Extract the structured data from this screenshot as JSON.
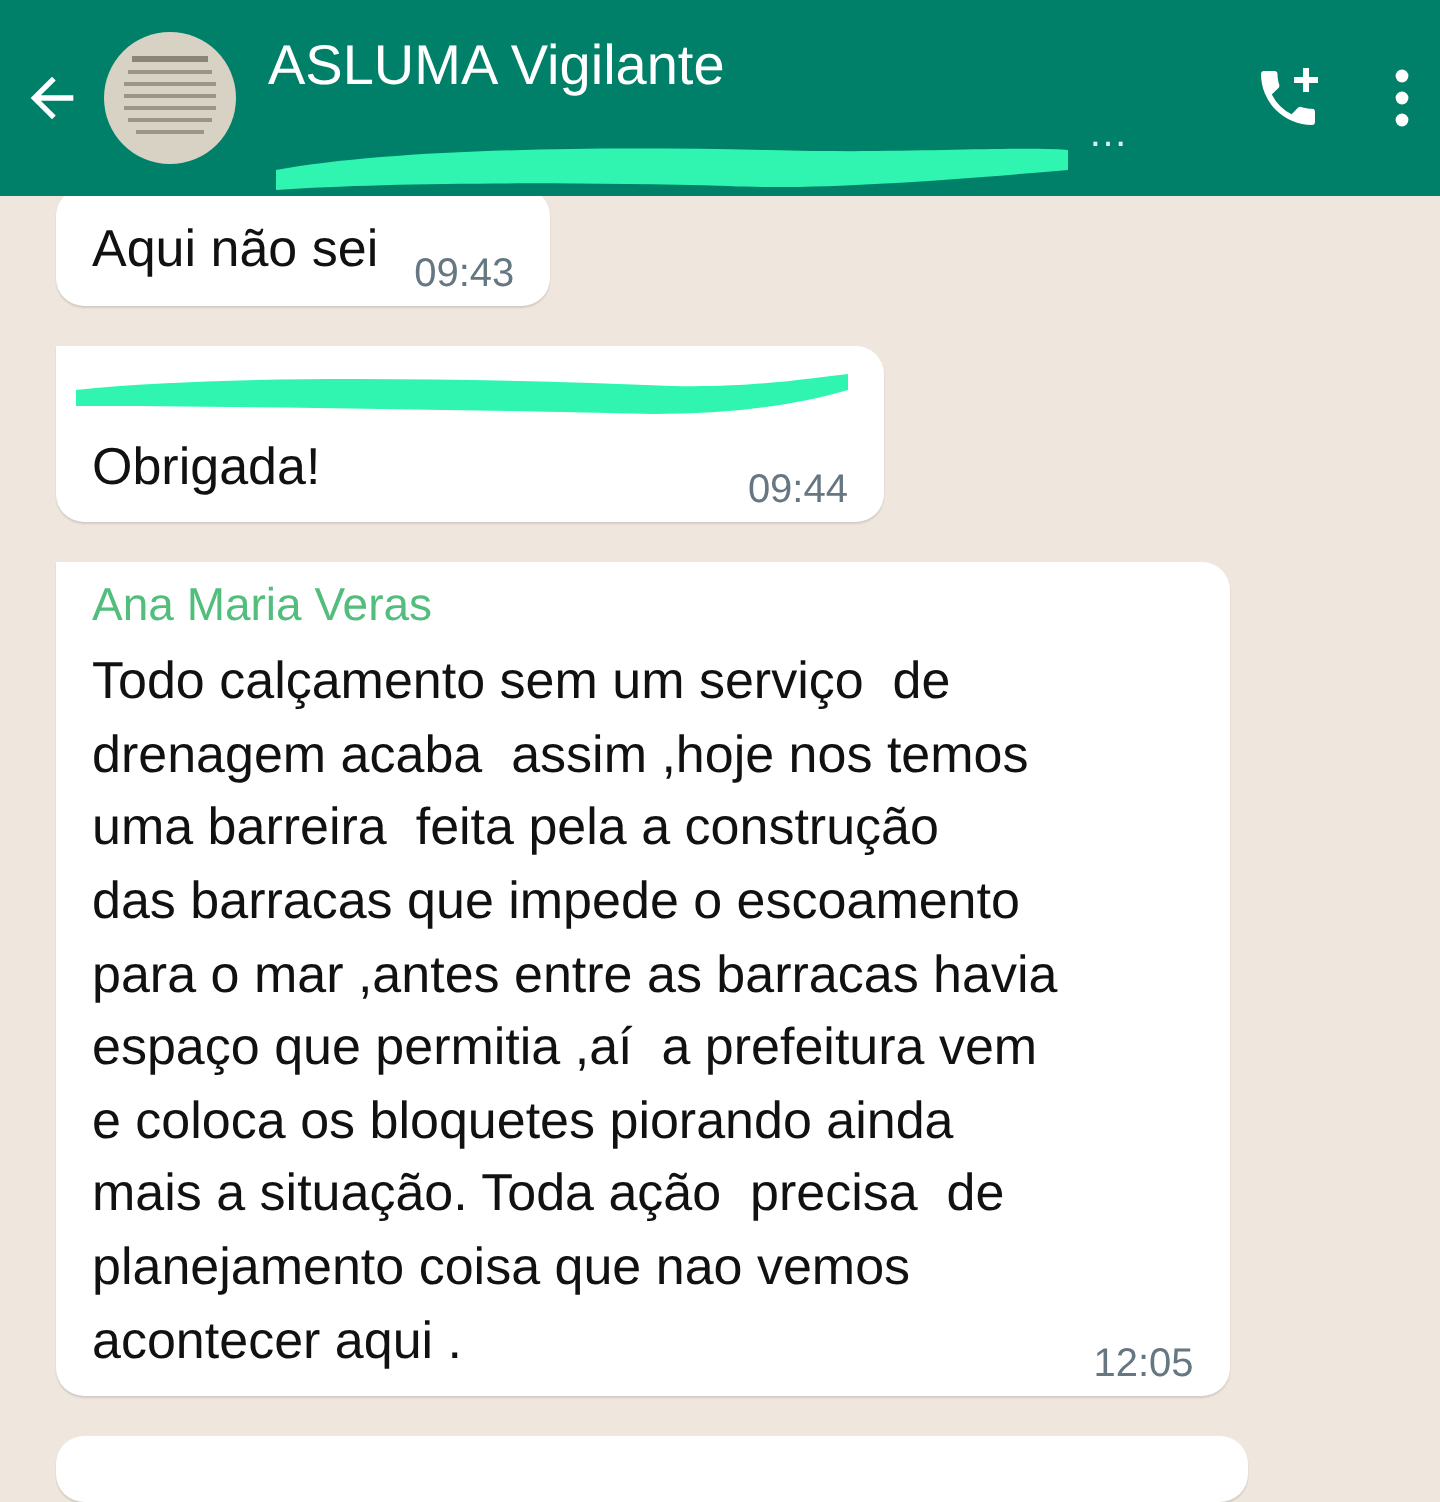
{
  "header": {
    "title": "ASLUMA Vigilante",
    "subtitle_end": "…"
  },
  "messages": [
    {
      "text": "Aqui não sei",
      "time": "09:43",
      "tail": false
    },
    {
      "sender": {
        "kind": "redacted"
      },
      "text": "Obrigada!",
      "time": "09:44",
      "tail": true
    },
    {
      "sender": {
        "kind": "name",
        "text": "Ana Maria Veras",
        "color": "#53bd7e"
      },
      "text": "Todo calçamento sem um serviço  de\ndrenagem acaba  assim ,hoje nos temos\numa barreira  feita pela a construção\ndas barracas que impede o escoamento\npara o mar ,antes entre as barracas havia\nespaço que permitia ,aí  a prefeitura vem\ne coloca os bloquetes piorando ainda\nmais a situação. Toda ação  precisa  de\nplanejamento coisa que nao vemos\nacontecer aqui .",
      "time": "12:05",
      "tail": true
    }
  ]
}
